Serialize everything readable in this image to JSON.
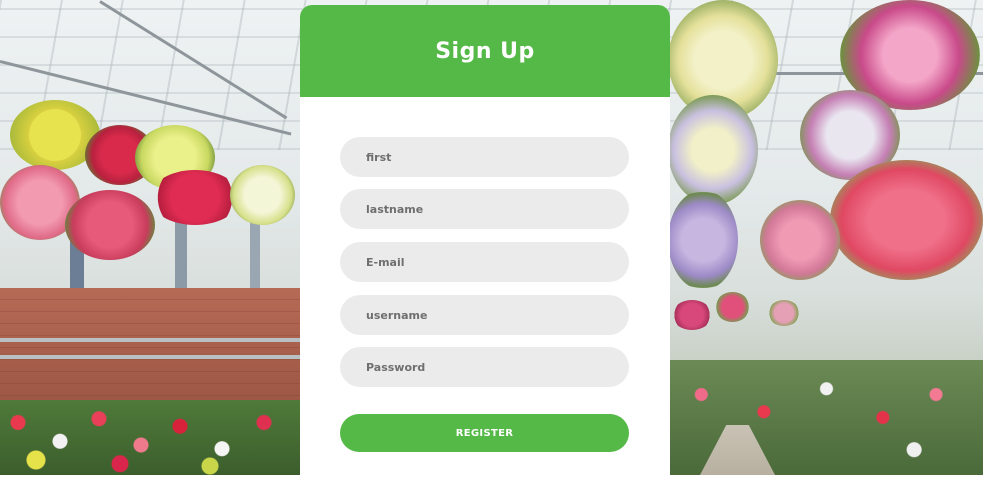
{
  "signup": {
    "title": "Sign Up",
    "fields": {
      "first": {
        "value": "",
        "placeholder": "first"
      },
      "lastname": {
        "value": "",
        "placeholder": "lastname"
      },
      "email": {
        "value": "",
        "placeholder": "E-mail"
      },
      "username": {
        "value": "",
        "placeholder": "username"
      },
      "password": {
        "value": "",
        "placeholder": "Password"
      }
    },
    "register_label": "REGISTER"
  },
  "colors": {
    "accent": "#55b947",
    "card_background": "#ffffff",
    "field_background": "#ebebeb",
    "field_text": "#6f6f6f"
  }
}
